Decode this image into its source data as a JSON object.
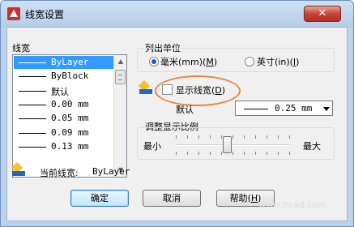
{
  "window": {
    "title": "线宽设置",
    "close_glyph": "✕"
  },
  "lineweights": {
    "label": "线宽",
    "items": [
      {
        "label": "ByLayer",
        "selected": true
      },
      {
        "label": "ByBlock",
        "selected": false
      },
      {
        "label": "默认",
        "selected": false
      },
      {
        "label": "0.00 mm",
        "selected": false
      },
      {
        "label": "0.05 mm",
        "selected": false
      },
      {
        "label": "0.09 mm",
        "selected": false
      },
      {
        "label": "0.13 mm",
        "selected": false
      }
    ],
    "current_label": "当前线宽:",
    "current_value": "ByLayer"
  },
  "units": {
    "label": "列出单位",
    "mm_label": "毫米(mm)",
    "mm_key": "M",
    "mm_selected": true,
    "in_label": "英寸(in)",
    "in_key": "I",
    "in_selected": false
  },
  "display": {
    "checkbox_label": "显示线宽",
    "checkbox_key": "D",
    "checked": false
  },
  "default": {
    "label": "默认",
    "value": "0.25 mm"
  },
  "scale": {
    "label": "调整显示比例",
    "min_label": "最小",
    "max_label": "最大",
    "position": 0.45
  },
  "buttons": {
    "ok": "确定",
    "cancel": "取消",
    "help": "帮助",
    "help_key": "H"
  },
  "watermark": "www.itcad.com",
  "colors": {
    "accent": "#3399ff",
    "highlight_ring": "#e8873c"
  }
}
